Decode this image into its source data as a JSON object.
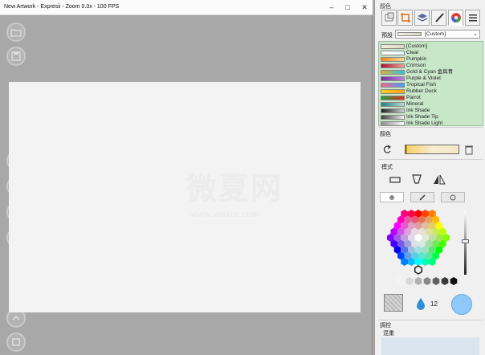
{
  "window": {
    "title": "New Artwork - Expresii - Zoom 0.3x - 100 FPS"
  },
  "panel": {
    "title": "顏色",
    "tabs": [
      "color-swatch-icon",
      "crop-icon",
      "layers-icon",
      "brush-icon",
      "color-wheel-icon",
      "menu-icon"
    ],
    "preset": {
      "label": "預設",
      "selected": "[Custom]"
    },
    "presets": [
      {
        "name": "[Custom]",
        "colors": [
          "#f6efe0",
          "#ddd4c2"
        ]
      },
      {
        "name": "Clear",
        "colors": [
          "#ffffff",
          "#e8f4ff"
        ]
      },
      {
        "name": "Pumpkin",
        "colors": [
          "#f08a1a",
          "#f6d6a0"
        ]
      },
      {
        "name": "Crimson",
        "colors": [
          "#b01030",
          "#f0a0a0"
        ]
      },
      {
        "name": "Gold & Cyan 金與青",
        "colors": [
          "#e0b030",
          "#30c0e0"
        ]
      },
      {
        "name": "Purple & Violet",
        "colors": [
          "#7030a0",
          "#c080e0"
        ]
      },
      {
        "name": "Tropical Fish",
        "colors": [
          "#ff6090",
          "#40a0ff"
        ]
      },
      {
        "name": "Rubber Duck",
        "colors": [
          "#f8d020",
          "#f0a020"
        ]
      },
      {
        "name": "Parrot",
        "colors": [
          "#20a040",
          "#e03020"
        ]
      },
      {
        "name": "Mineral",
        "colors": [
          "#208080",
          "#c0d8d8"
        ]
      },
      {
        "name": "Ink Shade",
        "colors": [
          "#202020",
          "#d0d0d0"
        ]
      },
      {
        "name": "Ink Shade Tip",
        "colors": [
          "#404040",
          "#f0f0f0"
        ]
      },
      {
        "name": "Ink Shade Light",
        "colors": [
          "#909090",
          "#f8f8f8"
        ]
      }
    ],
    "color_section": "顏色",
    "mode_section": "模式",
    "brush_size": "12",
    "adjust_section": "調控",
    "overlay_label": "混重",
    "current_color": "#8ec9f9"
  },
  "watermark": {
    "text": "微夏网",
    "sub": "www.xiaxia.com"
  }
}
